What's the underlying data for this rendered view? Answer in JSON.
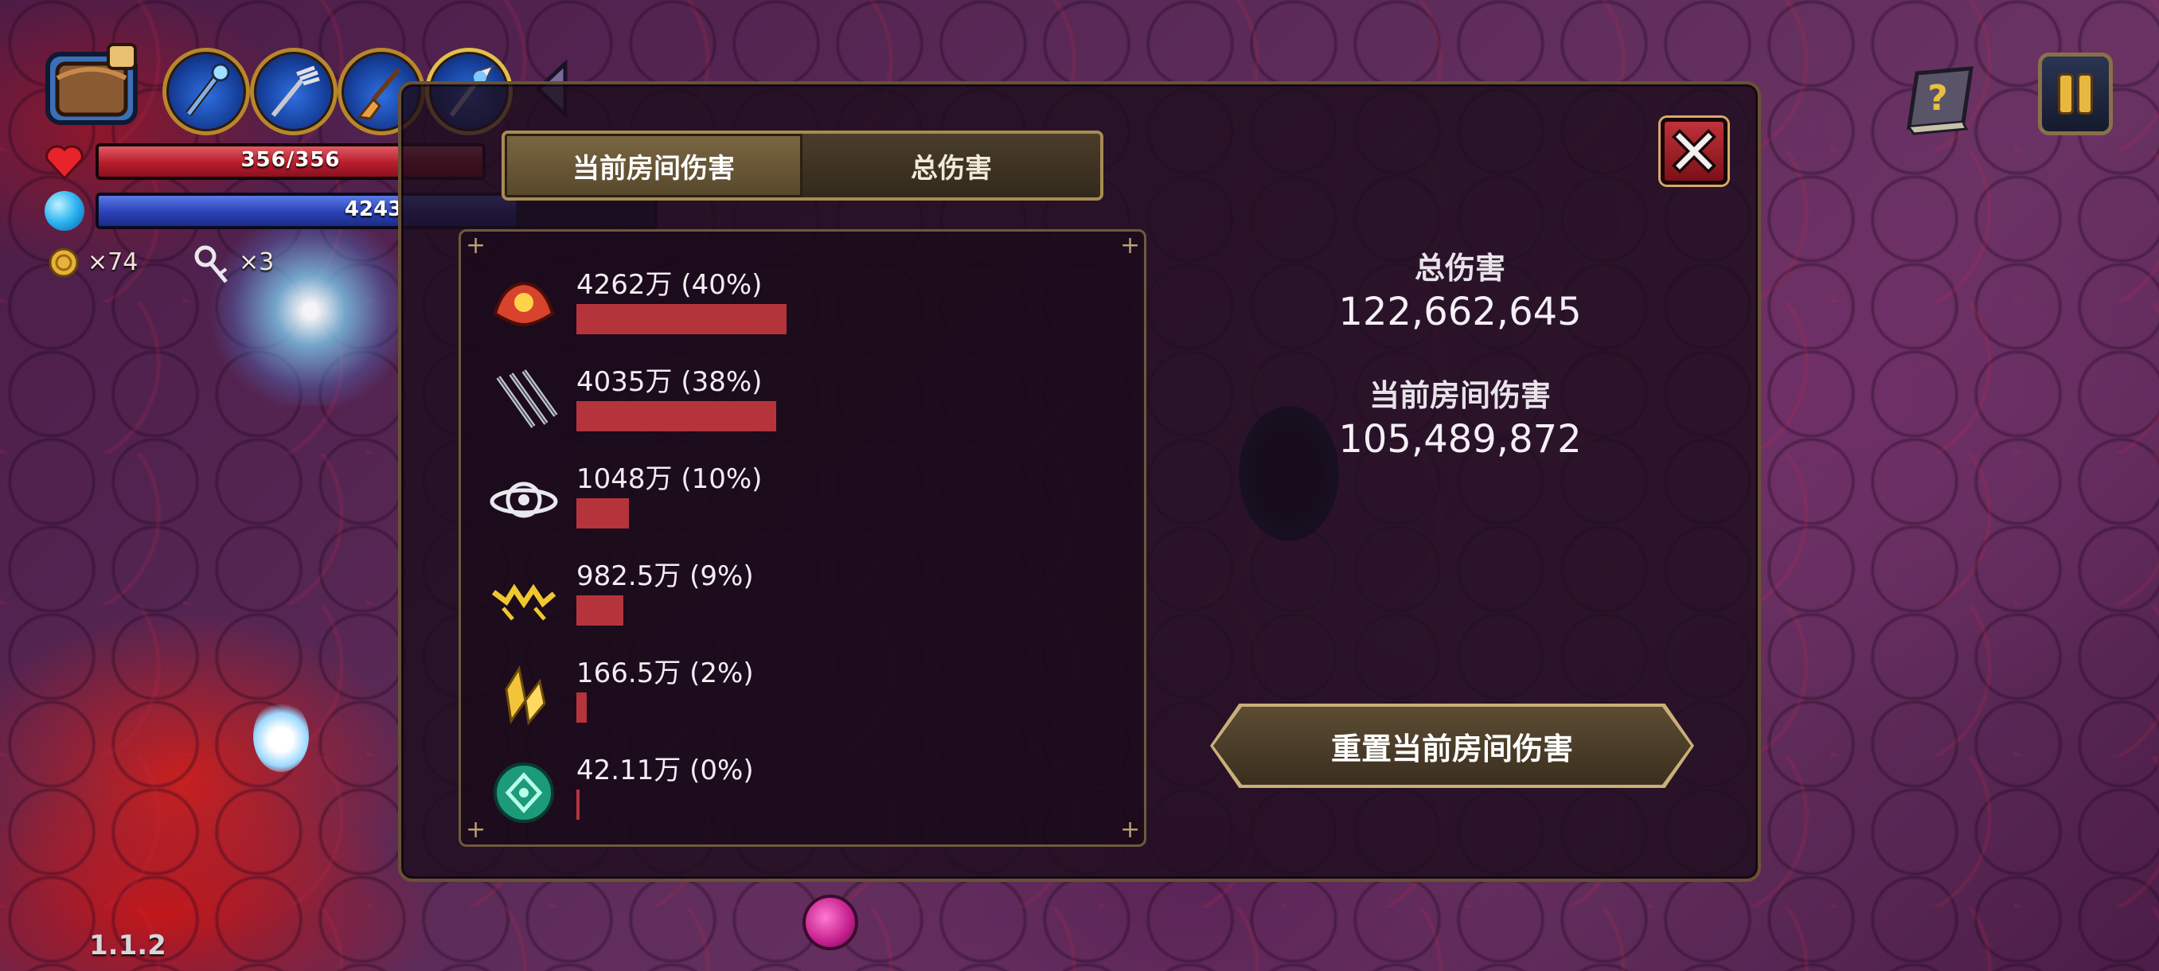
{
  "hud": {
    "hp_text": "356/356",
    "hp_fraction": 1.0,
    "mp_text": "4243",
    "mp_fraction": 0.75,
    "coins": "×74",
    "keys": "×3",
    "version": "1.1.2",
    "weapon_slots": [
      "blue-staff-icon",
      "fork-weapon-icon",
      "broom-weapon-icon",
      "winged-staff-icon"
    ]
  },
  "panel": {
    "tabs": [
      {
        "label": "当前房间伤害",
        "active": true
      },
      {
        "label": "总伤害",
        "active": false
      }
    ],
    "damage_rows": [
      {
        "icon": "fire-shell-icon",
        "label": "4262万 (40%)",
        "fraction": 0.4
      },
      {
        "icon": "triple-blade-icon",
        "label": "4035万 (38%)",
        "fraction": 0.38
      },
      {
        "icon": "orbit-ring-icon",
        "label": "1048万 (10%)",
        "fraction": 0.1
      },
      {
        "icon": "lightning-icon",
        "label": "982.5万 (9%)",
        "fraction": 0.09
      },
      {
        "icon": "crystal-shard-icon",
        "label": "166.5万 (2%)",
        "fraction": 0.02
      },
      {
        "icon": "green-rune-icon",
        "label": "42.11万 (0%)",
        "fraction": 0.0
      }
    ],
    "total_label": "总伤害",
    "total_value": "122,662,645",
    "room_label": "当前房间伤害",
    "room_value": "105,489,872",
    "reset_label": "重置当前房间伤害"
  },
  "colors": {
    "bar_red": "#b5343b",
    "hp_red": "#b61d2c",
    "mp_blue": "#2b41b5",
    "panel_border": "#a88b52",
    "close_red": "#c0323a"
  }
}
